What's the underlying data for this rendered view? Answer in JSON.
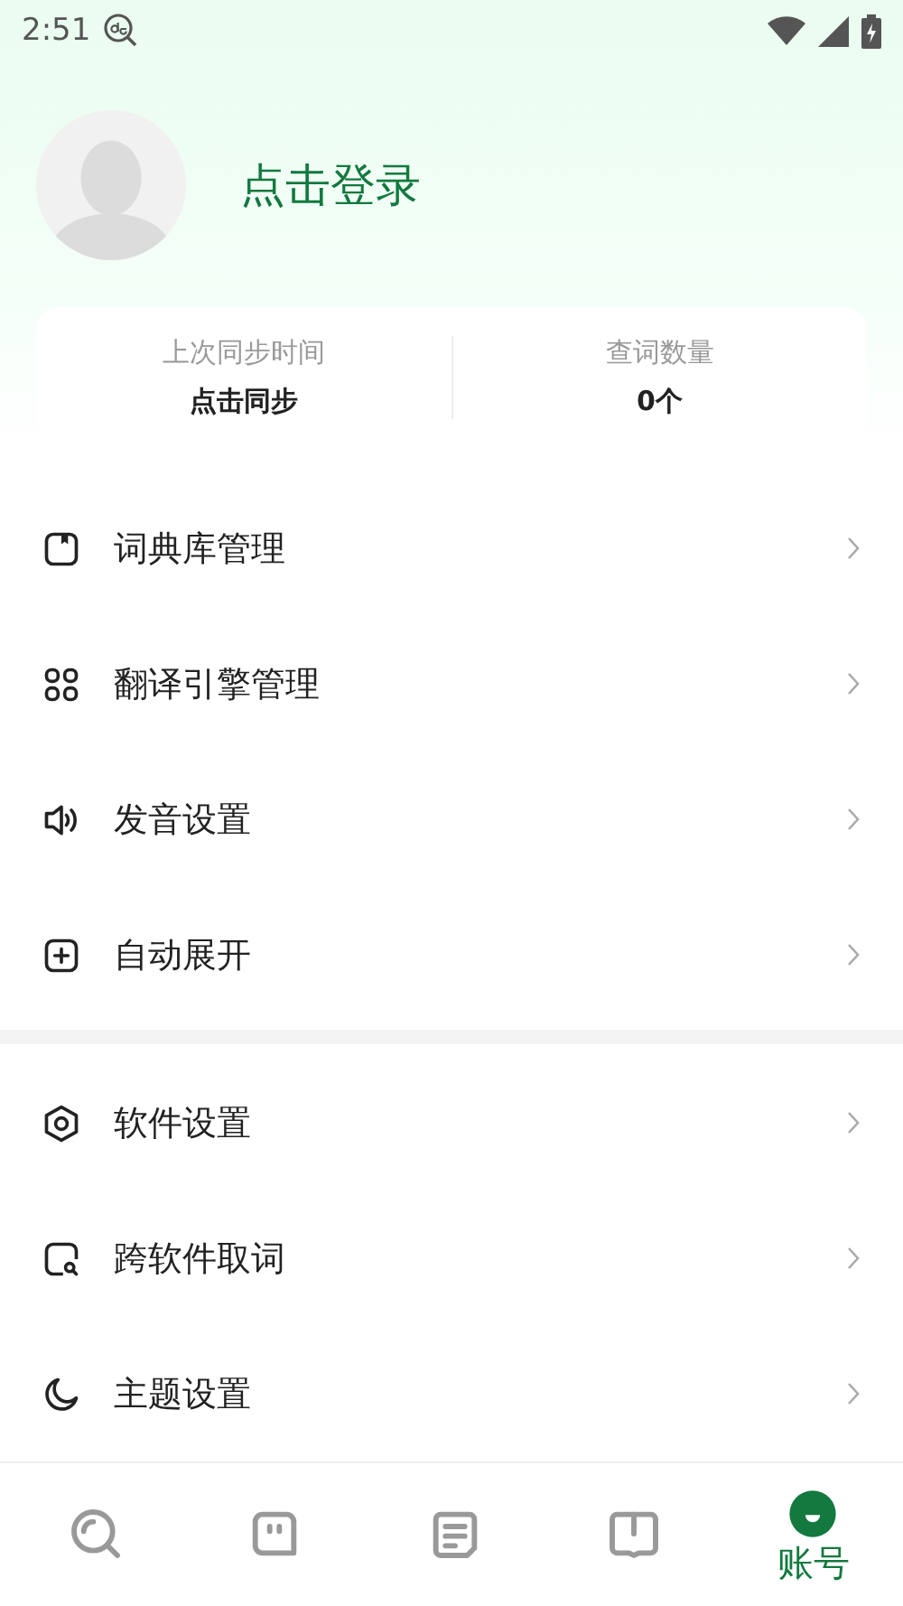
{
  "status_bar": {
    "time": "2:51"
  },
  "profile": {
    "login_label": "点击登录"
  },
  "stats": [
    {
      "label": "上次同步时间",
      "value": "点击同步"
    },
    {
      "label": "查词数量",
      "value": "0个"
    }
  ],
  "menu_groups": [
    [
      {
        "kind": "dictionary",
        "label": "词典库管理"
      },
      {
        "kind": "grid",
        "label": "翻译引擎管理"
      },
      {
        "kind": "speaker",
        "label": "发音设置"
      },
      {
        "kind": "plus",
        "label": "自动展开"
      }
    ],
    [
      {
        "kind": "hexagon",
        "label": "软件设置"
      },
      {
        "kind": "lookup",
        "label": "跨软件取词"
      },
      {
        "kind": "moon",
        "label": "主题设置"
      }
    ]
  ],
  "bottom_nav": [
    {
      "kind": "search",
      "selected": false
    },
    {
      "kind": "chat",
      "selected": false
    },
    {
      "kind": "note",
      "selected": false
    },
    {
      "kind": "book",
      "selected": false
    },
    {
      "kind": "account",
      "selected": true,
      "label": "账号"
    }
  ]
}
